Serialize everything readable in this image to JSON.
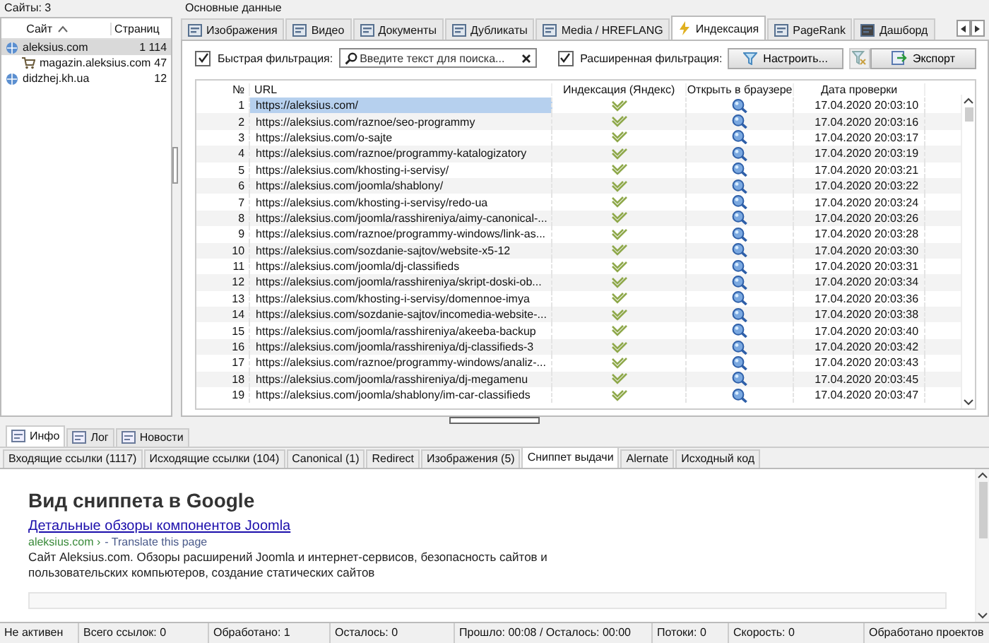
{
  "sites_panel": {
    "title": "Сайты: 3",
    "columns": [
      "Сайт",
      "Страниц"
    ],
    "sites": [
      {
        "name": "aleksius.com",
        "pages": "1 114",
        "selected": true,
        "children": [
          {
            "name": "magazin.aleksius.com",
            "pages": "47",
            "selected": false
          }
        ]
      },
      {
        "name": "didzhej.kh.ua",
        "pages": "12",
        "selected": false
      }
    ]
  },
  "main_panel": {
    "title": "Основные данные",
    "tabs": [
      {
        "label": "Изображения",
        "selected": false
      },
      {
        "label": "Видео",
        "selected": false
      },
      {
        "label": "Документы",
        "selected": false
      },
      {
        "label": "Дубликаты",
        "selected": false
      },
      {
        "label": "Media / HREFLANG",
        "selected": false
      },
      {
        "label": "Индексация",
        "selected": true
      },
      {
        "label": "PageRank",
        "selected": false
      },
      {
        "label": "Дашборд",
        "selected": false
      }
    ],
    "quick_filter": {
      "label": "Быстрая фильтрация:",
      "checked": true,
      "placeholder": "Введите текст для поиска..."
    },
    "extended_filter": {
      "label": "Расширенная фильтрация:",
      "checked": true,
      "button": "Настроить..."
    },
    "export_button": "Экспорт",
    "table": {
      "columns": [
        "№",
        "URL",
        "Индексация (Яндекс)",
        "Открыть в браузере",
        "Дата проверки"
      ],
      "rows": [
        {
          "n": "1",
          "url": "https://aleksius.com/",
          "indexed": true,
          "date": "17.04.2020 20:03:10",
          "selected": true
        },
        {
          "n": "2",
          "url": "https://aleksius.com/raznoe/seo-programmy",
          "indexed": true,
          "date": "17.04.2020 20:03:16",
          "selected": false
        },
        {
          "n": "3",
          "url": "https://aleksius.com/o-sajte",
          "indexed": true,
          "date": "17.04.2020 20:03:17",
          "selected": false
        },
        {
          "n": "4",
          "url": "https://aleksius.com/raznoe/programmy-katalogizatory",
          "indexed": true,
          "date": "17.04.2020 20:03:19",
          "selected": false
        },
        {
          "n": "5",
          "url": "https://aleksius.com/khosting-i-servisy/",
          "indexed": true,
          "date": "17.04.2020 20:03:21",
          "selected": false
        },
        {
          "n": "6",
          "url": "https://aleksius.com/joomla/shablony/",
          "indexed": true,
          "date": "17.04.2020 20:03:22",
          "selected": false
        },
        {
          "n": "7",
          "url": "https://aleksius.com/khosting-i-servisy/redo-ua",
          "indexed": true,
          "date": "17.04.2020 20:03:24",
          "selected": false
        },
        {
          "n": "8",
          "url": "https://aleksius.com/joomla/rasshireniya/aimy-canonical-...",
          "indexed": true,
          "date": "17.04.2020 20:03:26",
          "selected": false
        },
        {
          "n": "9",
          "url": "https://aleksius.com/raznoe/programmy-windows/link-as...",
          "indexed": true,
          "date": "17.04.2020 20:03:28",
          "selected": false
        },
        {
          "n": "10",
          "url": "https://aleksius.com/sozdanie-sajtov/website-x5-12",
          "indexed": true,
          "date": "17.04.2020 20:03:30",
          "selected": false
        },
        {
          "n": "11",
          "url": "https://aleksius.com/joomla/dj-classifieds",
          "indexed": true,
          "date": "17.04.2020 20:03:31",
          "selected": false
        },
        {
          "n": "12",
          "url": "https://aleksius.com/joomla/rasshireniya/skript-doski-ob...",
          "indexed": true,
          "date": "17.04.2020 20:03:34",
          "selected": false
        },
        {
          "n": "13",
          "url": "https://aleksius.com/khosting-i-servisy/domennoe-imya",
          "indexed": true,
          "date": "17.04.2020 20:03:36",
          "selected": false
        },
        {
          "n": "14",
          "url": "https://aleksius.com/sozdanie-sajtov/incomedia-website-...",
          "indexed": true,
          "date": "17.04.2020 20:03:38",
          "selected": false
        },
        {
          "n": "15",
          "url": "https://aleksius.com/joomla/rasshireniya/akeeba-backup",
          "indexed": true,
          "date": "17.04.2020 20:03:40",
          "selected": false
        },
        {
          "n": "16",
          "url": "https://aleksius.com/joomla/rasshireniya/dj-classifieds-3",
          "indexed": true,
          "date": "17.04.2020 20:03:42",
          "selected": false
        },
        {
          "n": "17",
          "url": "https://aleksius.com/raznoe/programmy-windows/analiz-...",
          "indexed": true,
          "date": "17.04.2020 20:03:43",
          "selected": false
        },
        {
          "n": "18",
          "url": "https://aleksius.com/joomla/rasshireniya/dj-megamenu",
          "indexed": true,
          "date": "17.04.2020 20:03:45",
          "selected": false
        },
        {
          "n": "19",
          "url": "https://aleksius.com/joomla/shablony/im-car-classifieds",
          "indexed": true,
          "date": "17.04.2020 20:03:47",
          "selected": false
        }
      ]
    }
  },
  "bottom_panel": {
    "tabs": [
      {
        "label": "Инфо",
        "selected": true
      },
      {
        "label": "Лог",
        "selected": false
      },
      {
        "label": "Новости",
        "selected": false
      }
    ],
    "subtabs": [
      {
        "label": "Входящие ссылки (1117)",
        "selected": false
      },
      {
        "label": "Исходящие ссылки (104)",
        "selected": false
      },
      {
        "label": "Canonical (1)",
        "selected": false
      },
      {
        "label": "Redirect",
        "selected": false
      },
      {
        "label": "Изображения (5)",
        "selected": false
      },
      {
        "label": "Сниппет выдачи",
        "selected": true
      },
      {
        "label": "Alernate",
        "selected": false
      },
      {
        "label": "Исходный код",
        "selected": false
      }
    ],
    "snippet": {
      "heading": "Вид сниппета в Google",
      "title": "Детальные обзоры компонентов Joomla",
      "url": "aleksius.com ›",
      "translate": "- Translate this page",
      "description": "Сайт Aleksius.com. Обзоры расширений Joomla и интернет-сервисов, безопасность сайтов и пользовательских компьютеров, создание статических сайтов"
    }
  },
  "status_bar": [
    "Не активен",
    "Всего ссылок: 0",
    "Обработано: 1",
    "Осталось: 0",
    "Прошло: 00:08 / Осталось: 00:00",
    "Потоки: 0",
    "Скорость: 0",
    "Обработано проектов"
  ]
}
